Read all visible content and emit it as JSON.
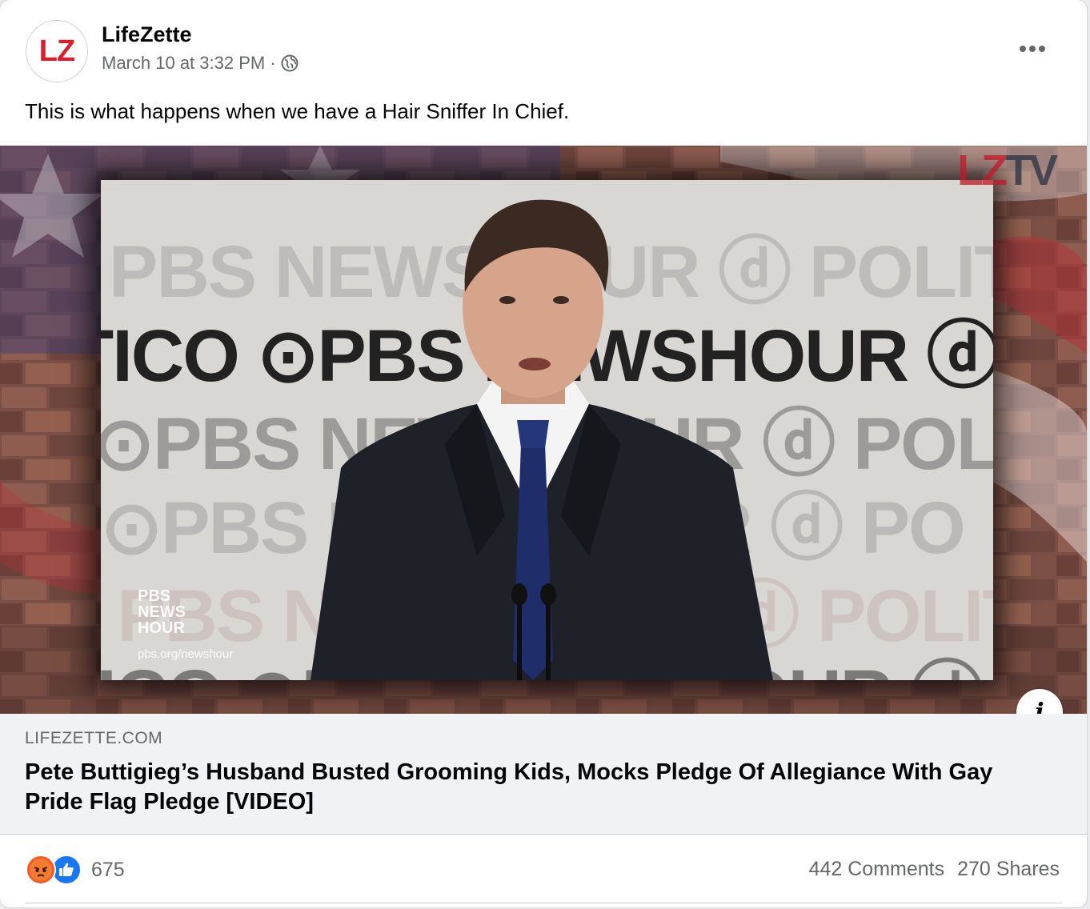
{
  "post": {
    "page_name": "LifeZette",
    "avatar_text": "LZ",
    "timestamp": "March 10 at 3:32 PM",
    "separator": "·",
    "privacy_icon": "globe-icon",
    "more_icon": "more-horizontal-icon",
    "text": "This is what happens when we have a Hair Sniffer In Chief."
  },
  "media": {
    "watermark_lz": "LZ",
    "watermark_tv": "TV",
    "wall_rows": [
      "PBS NEWSHOUR ⓓ POLITICO",
      "TICO ⊙PBS NEWSHOUR ⓓ",
      "⊙PBS NEWSHOUR ⓓ POLIT",
      "⊙PBS NEWSHOUR ⓓ PO",
      "PBS NEWSHOUR ⓓ POLITICO",
      "TICO ⊙PBS NEWSHOUR ⓓ"
    ],
    "bug_lines": [
      "PBS",
      "NEWS",
      "HOUR"
    ],
    "bug_url": "pbs.org/newshour",
    "info_icon": "info-icon",
    "info_glyph": "i"
  },
  "link": {
    "domain": "LIFEZETTE.COM",
    "title": "Pete Buttigieg’s Husband Busted Grooming Kids, Mocks Pledge Of Allegiance With Gay Pride Flag Pledge [VIDEO]"
  },
  "footer": {
    "reaction_icons": [
      "angry-reaction-icon",
      "like-reaction-icon"
    ],
    "reaction_count": "675",
    "comments": "442 Comments",
    "shares": "270 Shares"
  },
  "colors": {
    "brand_red": "#d81f30",
    "secondary_text": "#65676b",
    "link_bg": "#f0f2f5",
    "like_blue": "#1877f2",
    "angry_orange": "#f25c2a"
  }
}
